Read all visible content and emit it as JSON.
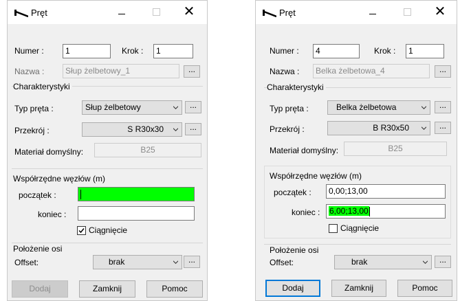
{
  "left": {
    "title": "Pręt",
    "numer_label": "Numer :",
    "numer_value": "1",
    "krok_label": "Krok :",
    "krok_value": "1",
    "nazwa_label": "Nazwa :",
    "nazwa_value": "Słup żelbetowy_1",
    "dots": "...",
    "charakterystyki_label": "Charakterystyki",
    "typ_label": "Typ pręta :",
    "typ_value": "Słup żelbetowy",
    "przekroj_label": "Przekrój :",
    "przekroj_value": "S R30x30",
    "material_label": "Materiał domyślny:",
    "material_value": "B25",
    "wspolrzedne_label": "Współrzędne węzłów (m)",
    "poczatek_label": "początek :",
    "poczatek_value": "",
    "koniec_label": "koniec :",
    "koniec_value": "",
    "ciagniecie_label": "Ciągnięcie",
    "ciagniecie_checked": true,
    "polozenie_label": "Położenie osi",
    "offset_label": "Offset:",
    "offset_value": "brak",
    "dodaj_label": "Dodaj",
    "zamknij_label": "Zamknij",
    "pomoc_label": "Pomoc"
  },
  "right": {
    "title": "Pręt",
    "numer_label": "Numer :",
    "numer_value": "4",
    "krok_label": "Krok :",
    "krok_value": "1",
    "nazwa_label": "Nazwa :",
    "nazwa_value": "Belka żelbetowa_4",
    "dots": "...",
    "charakterystyki_label": "Charakterystyki",
    "typ_label": "Typ pręta :",
    "typ_value": "Belka żelbetowa",
    "przekroj_label": "Przekrój :",
    "przekroj_value": "B R30x50",
    "material_label": "Materiał domyślny:",
    "material_value": "B25",
    "wspolrzedne_label": "Współrzędne węzłów (m)",
    "poczatek_label": "początek :",
    "poczatek_value": "0,00;13,00",
    "koniec_label": "koniec :",
    "koniec_value": "6,00;13,00",
    "ciagniecie_label": "Ciągnięcie",
    "ciagniecie_checked": false,
    "polozenie_label": "Położenie osi",
    "offset_label": "Offset:",
    "offset_value": "brak",
    "dodaj_label": "Dodaj",
    "zamknij_label": "Zamknij",
    "pomoc_label": "Pomoc"
  },
  "icons": {
    "title_icon": "beam-element-icon",
    "minimize": "minimize-icon",
    "maximize": "maximize-icon",
    "close": "close-icon",
    "dropdown": "chevron-down-icon",
    "checkbox_mark": "checkmark-icon"
  },
  "colors": {
    "highlight_field": "#00ff00",
    "default_button_border": "#0078d7",
    "dialog_background": "#f0f0f0"
  },
  "close_glyph": "✕"
}
